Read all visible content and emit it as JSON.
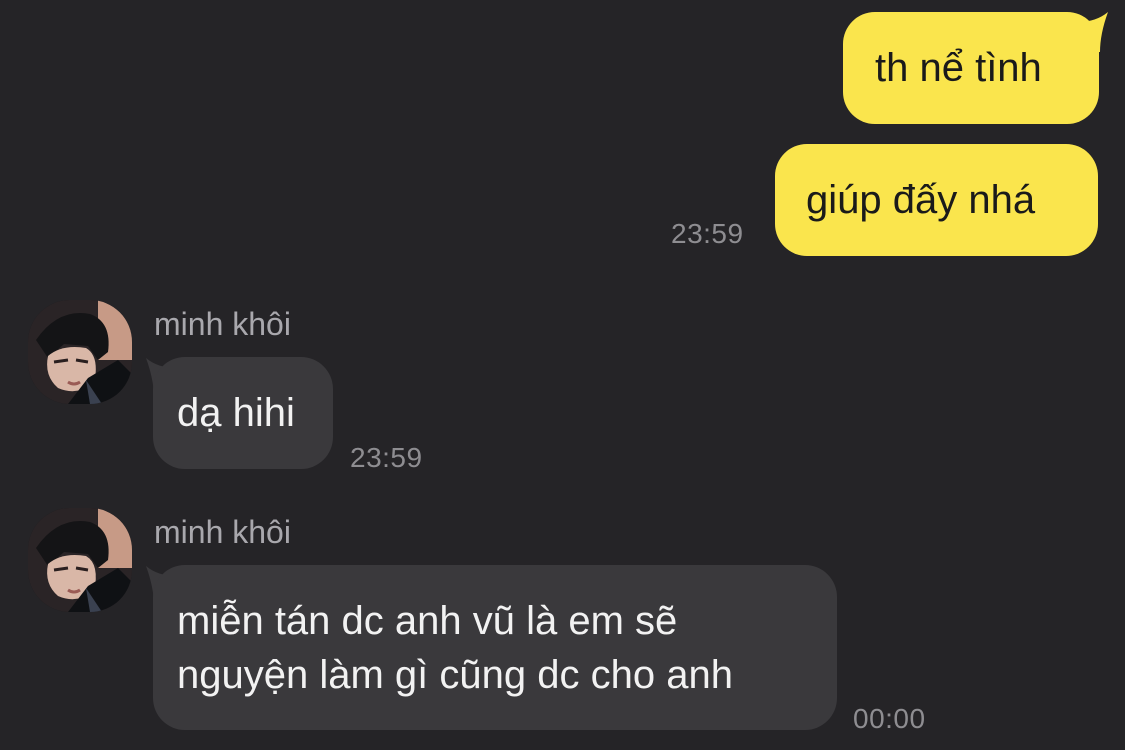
{
  "colors": {
    "background": "#252427",
    "outgoing_bubble": "#FAE54D",
    "incoming_bubble": "#3A393C",
    "timestamp": "#8e8d91",
    "sender_name": "#a9a8ad"
  },
  "messages": [
    {
      "direction": "outgoing",
      "text": "th nể tình"
    },
    {
      "direction": "outgoing",
      "text": "giúp đấy nhá",
      "time": "23:59"
    },
    {
      "direction": "incoming",
      "sender": "minh khôi",
      "avatar": "profile-photo",
      "text": "dạ hihi",
      "time": "23:59"
    },
    {
      "direction": "incoming",
      "sender": "minh khôi",
      "avatar": "profile-photo",
      "text_line1": "miễn tán dc anh vũ là em sẽ",
      "text_line2": "nguyện làm gì cũng dc cho anh",
      "time": "00:00"
    }
  ]
}
